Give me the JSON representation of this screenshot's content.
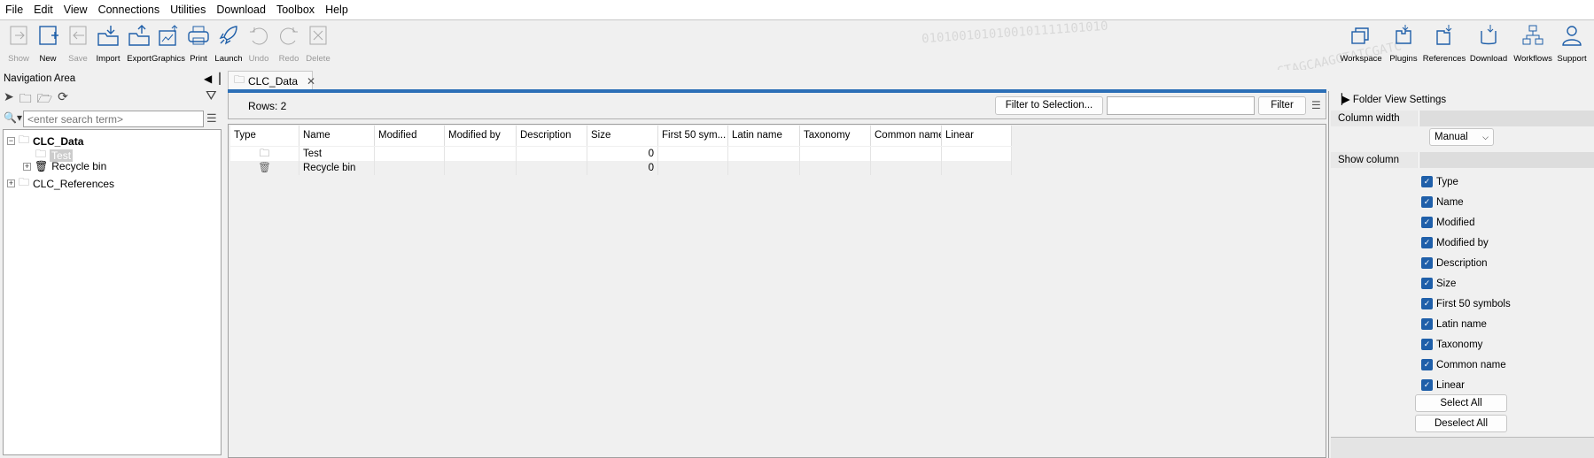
{
  "menu": [
    "File",
    "Edit",
    "View",
    "Connections",
    "Utilities",
    "Download",
    "Toolbox",
    "Help"
  ],
  "toolbar": [
    {
      "label": "Show",
      "icon": "show-icon",
      "enabled": false
    },
    {
      "label": "New",
      "icon": "new-icon",
      "enabled": true
    },
    {
      "label": "Save",
      "icon": "save-icon",
      "enabled": false
    },
    {
      "label": "Import",
      "icon": "import-icon",
      "enabled": true
    },
    {
      "label": "Export",
      "icon": "export-icon",
      "enabled": true
    },
    {
      "label": "Graphics",
      "icon": "graphics-icon",
      "enabled": true
    },
    {
      "label": "Print",
      "icon": "print-icon",
      "enabled": true
    },
    {
      "label": "Launch",
      "icon": "rocket-icon",
      "enabled": true
    },
    {
      "label": "Undo",
      "icon": "undo-icon",
      "enabled": false
    },
    {
      "label": "Redo",
      "icon": "redo-icon",
      "enabled": false
    },
    {
      "label": "Delete",
      "icon": "delete-icon",
      "enabled": false
    }
  ],
  "toolbar_right": [
    {
      "label": "Workspace",
      "icon": "workspace-icon"
    },
    {
      "label": "Plugins",
      "icon": "plugins-icon"
    },
    {
      "label": "References",
      "icon": "references-icon"
    },
    {
      "label": "Download",
      "icon": "download-icon"
    },
    {
      "label": "Workflows",
      "icon": "workflows-icon"
    },
    {
      "label": "Support",
      "icon": "support-icon"
    }
  ],
  "nav": {
    "title": "Navigation Area",
    "search_placeholder": "<enter search term>",
    "tree": [
      {
        "label": "CLC_Data",
        "bold": true
      },
      {
        "label": "Test",
        "selected": true
      },
      {
        "label": "Recycle bin"
      },
      {
        "label": "CLC_References"
      }
    ]
  },
  "tab": {
    "label": "CLC_Data"
  },
  "rows_label": "Rows: 2",
  "filter_selection": "Filter to Selection...",
  "filter_input": "",
  "filter_button": "Filter",
  "table": {
    "columns": [
      "Type",
      "Name",
      "Modified",
      "Modified by",
      "Description",
      "Size",
      "First 50 sym...",
      "Latin name",
      "Taxonomy",
      "Common name",
      "Linear"
    ],
    "rows": [
      {
        "type": "folder",
        "name": "Test",
        "size": "0"
      },
      {
        "type": "recycle-bin",
        "name": "Recycle bin",
        "size": "0"
      }
    ]
  },
  "settings": {
    "title": "Folder View Settings",
    "column_width_label": "Column width",
    "column_width_value": "Manual",
    "show_column_label": "Show column",
    "columns": [
      "Type",
      "Name",
      "Modified",
      "Modified by",
      "Description",
      "Size",
      "First 50 symbols",
      "Latin name",
      "Taxonomy",
      "Common name",
      "Linear"
    ],
    "select_all": "Select All",
    "deselect_all": "Deselect All"
  },
  "colors": {
    "accent": "#2c6fb7",
    "icon": "#1f5fa9"
  }
}
